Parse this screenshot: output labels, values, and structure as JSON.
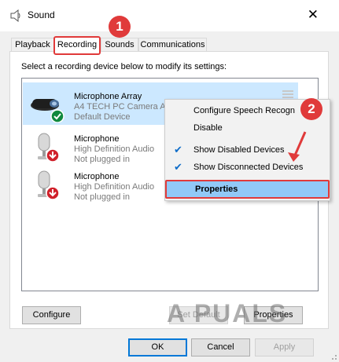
{
  "window": {
    "title": "Sound"
  },
  "tabs": [
    {
      "label": "Playback"
    },
    {
      "label": "Recording"
    },
    {
      "label": "Sounds"
    },
    {
      "label": "Communications"
    }
  ],
  "instruction": "Select a recording device below to modify its settings:",
  "devices": [
    {
      "name": "Microphone Array",
      "subtitle": "A4 TECH PC Camera Au",
      "status": "Default Device",
      "icon": "webcam-icon",
      "status_icon": "default-check-icon"
    },
    {
      "name": "Microphone",
      "subtitle": "High Definition Audio",
      "status": "Not plugged in",
      "icon": "microphone-icon",
      "status_icon": "unplugged-arrow-icon"
    },
    {
      "name": "Microphone",
      "subtitle": "High Definition Audio",
      "status": "Not plugged in",
      "icon": "microphone-icon",
      "status_icon": "unplugged-arrow-icon"
    }
  ],
  "context_menu": {
    "items": [
      {
        "label": "Configure Speech Recogn",
        "checked": false
      },
      {
        "label": "Disable",
        "checked": false
      },
      {
        "label": "Show Disabled Devices",
        "checked": true
      },
      {
        "label": "Show Disconnected Devices",
        "checked": true
      },
      {
        "label": "Properties",
        "checked": false,
        "highlighted": true
      }
    ]
  },
  "buttons": {
    "configure": "Configure",
    "set_default": "Set Default",
    "properties": "Properties",
    "ok": "OK",
    "cancel": "Cancel",
    "apply": "Apply"
  },
  "annotations": {
    "step1": "1",
    "step2": "2"
  },
  "watermark": "A PUALS",
  "colors": {
    "annotation_red": "#e03a3a",
    "selection_blue": "#cce8ff",
    "menu_highlight": "#91c9f7",
    "default_green": "#10893e"
  }
}
